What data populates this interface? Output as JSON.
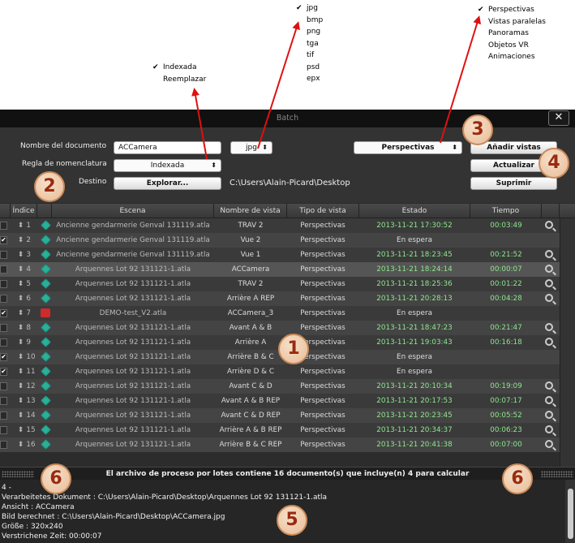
{
  "callouts": {
    "naming_options": [
      {
        "label": "Indexada",
        "checked": true
      },
      {
        "label": "Reemplazar",
        "checked": false
      }
    ],
    "format_options": [
      {
        "label": "jpg",
        "checked": true
      },
      {
        "label": "bmp",
        "checked": false
      },
      {
        "label": "png",
        "checked": false
      },
      {
        "label": "tga",
        "checked": false
      },
      {
        "label": "tif",
        "checked": false
      },
      {
        "label": "psd",
        "checked": false
      },
      {
        "label": "epx",
        "checked": false
      }
    ],
    "view_options": [
      {
        "label": "Perspectivas",
        "checked": true
      },
      {
        "label": "Vistas paralelas",
        "checked": false
      },
      {
        "label": "Panoramas",
        "checked": false
      },
      {
        "label": "Objetos VR",
        "checked": false
      },
      {
        "label": "Animaciones",
        "checked": false
      }
    ],
    "arrow_color": "#e01010"
  },
  "window": {
    "title": "Batch",
    "close_glyph": "✕"
  },
  "form": {
    "doc_name_label": "Nombre del documento",
    "doc_name_value": "ACCamera",
    "format_value": "jpg",
    "naming_label": "Regla de nomenclatura",
    "naming_value": "Indexada",
    "dest_label": "Destino",
    "browse_label": "Explorar...",
    "dest_path": "C:\\Users\\Alain-Picard\\Desktop",
    "view_type_value": "Perspectivas",
    "add_views_label": "Añadir vistas",
    "update_label": "Actualizar",
    "delete_label": "Suprimir",
    "updown_glyph": "⬍"
  },
  "table": {
    "headers": [
      "Índice",
      "Escena",
      "Nombre de vista",
      "Tipo de vista",
      "Estado",
      "Tiempo"
    ],
    "rows": [
      {
        "checked": false,
        "index": "1",
        "icon": "gem-icon",
        "scene": "Ancienne gendarmerie Genval 131119.atla",
        "view": "TRAV 2",
        "type": "Perspectivas",
        "state": "2013-11-21 17:30:52",
        "done": true,
        "time": "00:03:49",
        "zoom": true
      },
      {
        "checked": true,
        "index": "2",
        "icon": "gem-icon",
        "scene": "Ancienne gendarmerie Genval 131119.atla",
        "view": "Vue 2",
        "type": "Perspectivas",
        "state": "En espera",
        "done": false,
        "time": "",
        "zoom": false
      },
      {
        "checked": false,
        "index": "3",
        "icon": "gem-icon",
        "scene": "Ancienne gendarmerie Genval 131119.atla",
        "view": "Vue 1",
        "type": "Perspectivas",
        "state": "2013-11-21 18:23:45",
        "done": true,
        "time": "00:21:52",
        "zoom": true
      },
      {
        "checked": false,
        "index": "4",
        "icon": "gem-icon",
        "scene": "Arquennes Lot 92 131121-1.atla",
        "view": "ACCamera",
        "type": "Perspectivas",
        "state": "2013-11-21 18:24:14",
        "done": true,
        "time": "00:00:07",
        "zoom": true
      },
      {
        "checked": false,
        "index": "5",
        "icon": "gem-icon",
        "scene": "Arquennes Lot 92 131121-1.atla",
        "view": "TRAV 2",
        "type": "Perspectivas",
        "state": "2013-11-21 18:25:36",
        "done": true,
        "time": "00:01:22",
        "zoom": true
      },
      {
        "checked": false,
        "index": "6",
        "icon": "gem-icon",
        "scene": "Arquennes Lot 92 131121-1.atla",
        "view": "Arrière  A REP",
        "type": "Perspectivas",
        "state": "2013-11-21 20:28:13",
        "done": true,
        "time": "00:04:28",
        "zoom": true
      },
      {
        "checked": true,
        "index": "7",
        "icon": "red-file-icon",
        "scene": "DEMO-test_V2.atla",
        "view": "ACCamera_3",
        "type": "Perspectivas",
        "state": "En espera",
        "done": false,
        "time": "",
        "zoom": false
      },
      {
        "checked": false,
        "index": "8",
        "icon": "gem-icon",
        "scene": "Arquennes Lot 92 131121-1.atla",
        "view": "Avant A & B",
        "type": "Perspectivas",
        "state": "2013-11-21 18:47:23",
        "done": true,
        "time": "00:21:47",
        "zoom": true
      },
      {
        "checked": false,
        "index": "9",
        "icon": "gem-icon",
        "scene": "Arquennes Lot 92 131121-1.atla",
        "view": "Arrière  A",
        "type": "Perspectivas",
        "state": "2013-11-21 19:03:43",
        "done": true,
        "time": "00:16:18",
        "zoom": true
      },
      {
        "checked": true,
        "index": "10",
        "icon": "gem-icon",
        "scene": "Arquennes Lot 92 131121-1.atla",
        "view": "Arrière  B & C",
        "type": "Perspectivas",
        "state": "En espera",
        "done": false,
        "time": "",
        "zoom": false
      },
      {
        "checked": true,
        "index": "11",
        "icon": "gem-icon",
        "scene": "Arquennes Lot 92 131121-1.atla",
        "view": "Arrière  D & C",
        "type": "Perspectivas",
        "state": "En espera",
        "done": false,
        "time": "",
        "zoom": false
      },
      {
        "checked": false,
        "index": "12",
        "icon": "gem-icon",
        "scene": "Arquennes Lot 92 131121-1.atla",
        "view": "Avant C & D",
        "type": "Perspectivas",
        "state": "2013-11-21 20:10:34",
        "done": true,
        "time": "00:19:09",
        "zoom": true
      },
      {
        "checked": false,
        "index": "13",
        "icon": "gem-icon",
        "scene": "Arquennes Lot 92 131121-1.atla",
        "view": "Avant A & B REP",
        "type": "Perspectivas",
        "state": "2013-11-21 20:17:53",
        "done": true,
        "time": "00:07:17",
        "zoom": true
      },
      {
        "checked": false,
        "index": "14",
        "icon": "gem-icon",
        "scene": "Arquennes Lot 92 131121-1.atla",
        "view": "Avant C & D REP",
        "type": "Perspectivas",
        "state": "2013-11-21 20:23:45",
        "done": true,
        "time": "00:05:52",
        "zoom": true
      },
      {
        "checked": false,
        "index": "15",
        "icon": "gem-icon",
        "scene": "Arquennes Lot 92 131121-1.atla",
        "view": "Arrière  A & B REP",
        "type": "Perspectivas",
        "state": "2013-11-21 20:34:37",
        "done": true,
        "time": "00:06:23",
        "zoom": true
      },
      {
        "checked": false,
        "index": "16",
        "icon": "gem-icon",
        "scene": "Arquennes Lot 92 131121-1.atla",
        "view": "Arrière  B & C REP",
        "type": "Perspectivas",
        "state": "2013-11-21 20:41:38",
        "done": true,
        "time": "00:07:00",
        "zoom": true
      }
    ],
    "sort_glyph": "⬍",
    "check_glyph": "✔"
  },
  "status": {
    "message": "El archivo de proceso por lotes contiene 16 documento(s) que incluye(n) 4 para calcular"
  },
  "log": {
    "lines": [
      "4 -",
      "Verarbeitetes Dokument : C:\\Users\\Alain-Picard\\Desktop\\Arquennes Lot 92 131121-1.atla",
      "Ansicht : ACCamera",
      "Bild berechnet : C:\\Users\\Alain-Picard\\Desktop\\ACCamera.jpg",
      "Größe : 320x240",
      "Verstrichene Zeit: 00:00:07"
    ]
  },
  "badges": [
    "1",
    "2",
    "3",
    "4",
    "5",
    "6",
    "6"
  ]
}
